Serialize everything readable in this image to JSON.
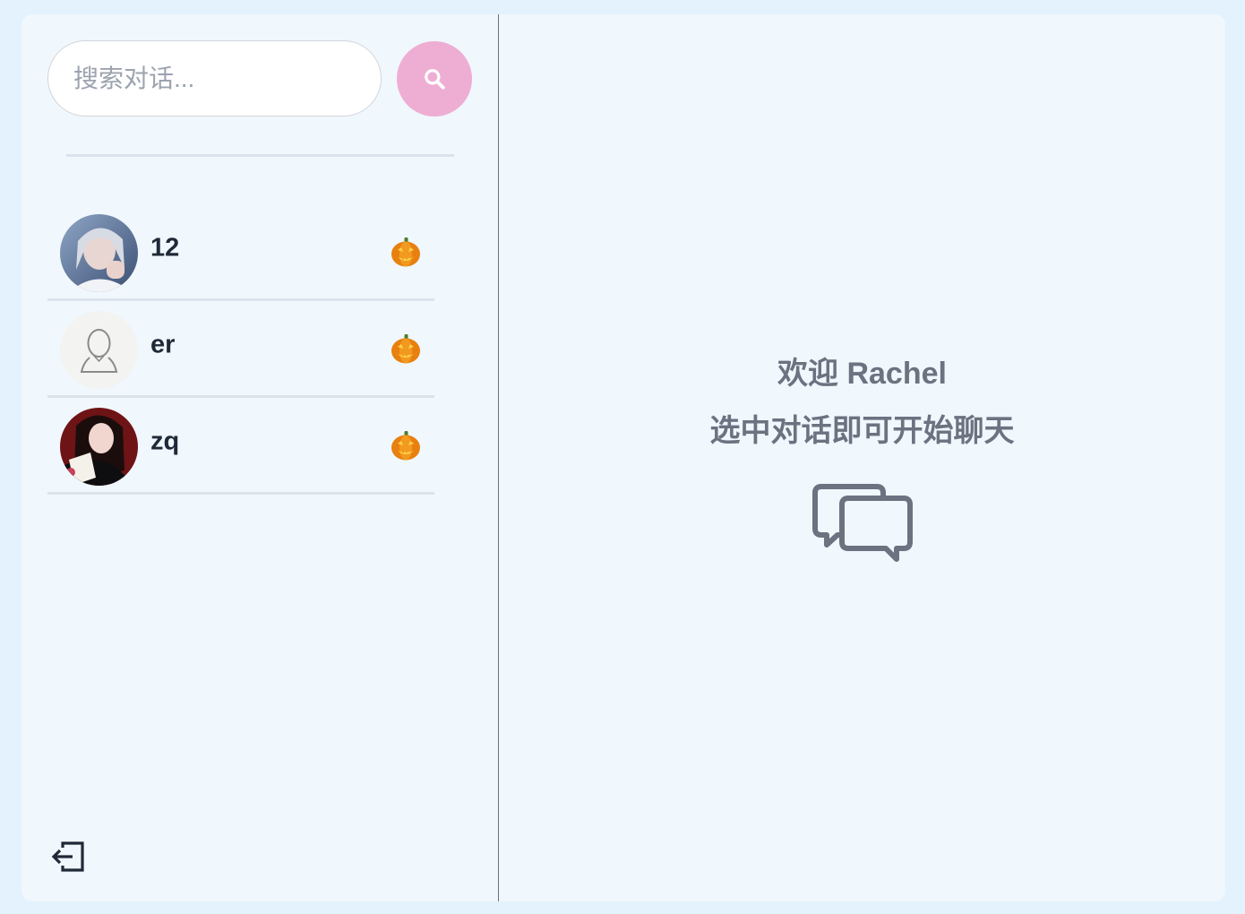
{
  "search": {
    "placeholder": "搜索对话...",
    "value": "",
    "button_icon": "search-icon"
  },
  "conversations": [
    {
      "name": "12",
      "status_emoji": "pumpkin",
      "avatar": "photo-avatar"
    },
    {
      "name": "er",
      "status_emoji": "pumpkin",
      "avatar": "default-user-avatar"
    },
    {
      "name": "zq",
      "status_emoji": "pumpkin",
      "avatar": "photo-avatar"
    }
  ],
  "welcome": {
    "line1": "欢迎 Rachel",
    "line2": "选中对话即可开始聊天",
    "icon": "chat-bubbles-icon"
  },
  "logout": {
    "icon": "logout-icon"
  },
  "colors": {
    "background": "#e3f2fd",
    "panel": "#f0f7fd",
    "search_button": "#eeaed4",
    "divider": "#dbe3ec",
    "muted_text": "#6b7280",
    "name_text": "#1f2937"
  }
}
